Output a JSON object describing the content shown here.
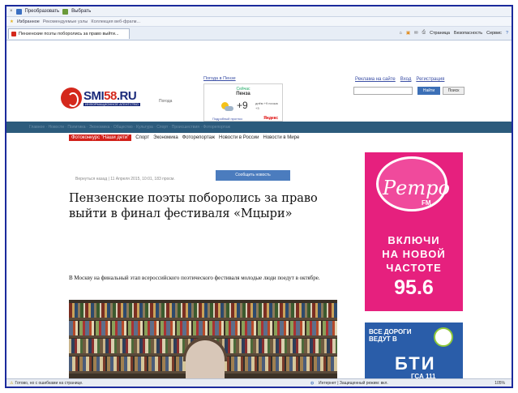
{
  "browser": {
    "menu": [
      "Преобразовать",
      "Выбрать"
    ],
    "favorites_label": "Избранное",
    "favorites_items": [
      "Рекомендуемые узлы",
      "Коллекция веб-фрагм..."
    ],
    "tab_title": "Пензенские поэты поборолись за право выйти...",
    "toolbar": [
      "Страница",
      "Безопасность",
      "Сервис"
    ],
    "status_left": "Готово, но с ошибками на странице.",
    "status_zone": "Интернет | Защищенный режим: вкл.",
    "zoom": "105%"
  },
  "site": {
    "logo_main": "SMI",
    "logo_accent": "58",
    "logo_tld": ".RU",
    "logo_sub": "ИНФОРМАЦИОННОЕ АГЕНТСТВО",
    "pogoda_label": "Погода",
    "pogoda_top": "Погода в Пензе",
    "weather": {
      "city_small": "Сейчас",
      "city": "Пенза",
      "temp": "+9",
      "details": "днём +9 ночью +3",
      "link": "Подробный прогноз",
      "yandex": "Яндекс"
    },
    "links": [
      "Реклама на сайте",
      "Вход",
      "Регистрация"
    ],
    "search_btn": "Найти",
    "adv_btn": "Поиск",
    "ticker": "Главное · Новости · Политика · Экономика · Общество · Культура · Спорт · Происшествия · Фоторепортаж",
    "nav": [
      "Фотоконкурс \"Наши дети\"",
      "Спорт",
      "Экономика",
      "Фоторепортаж",
      "Новости в России",
      "Новости в Мире"
    ]
  },
  "article": {
    "date": "Вернуться назад | 11 Апреля 2015, 10:01, 183 просм.",
    "share": "Сообщить новость",
    "title": "Пензенские поэты поборолись за право выйти в финал фестиваля «Мцыри»",
    "lead": "В Москву на финальный этап всероссийского поэтического фестиваля молодые люди поедут в октябре."
  },
  "ads": {
    "retro_logo": "Ретро",
    "retro_fm": "FM",
    "retro_line1": "ВКЛЮЧИ",
    "retro_line2": "НА НОВОЙ",
    "retro_line3": "ЧАСТОТЕ",
    "retro_freq": "95.6",
    "bti_slogan": "ВСЕ ДОРОГИ ВЕДУТ В",
    "bti_big": "БТИ",
    "bti_num": "ГСА 111"
  }
}
